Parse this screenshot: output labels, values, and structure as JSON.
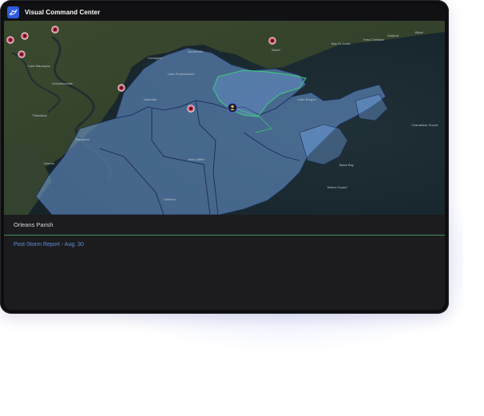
{
  "app": {
    "title": "Visual Command Center",
    "logo_icon": "bird-icon",
    "accent": "#2f5be0"
  },
  "map": {
    "selected_region": "Orleans Parish",
    "highlight_color": "#7fb4ff",
    "boundary_color": "#1b2a55",
    "selected_outline": "#39d17a",
    "place_labels": [
      "Covington",
      "Mandeville",
      "Slidell",
      "Bay St. Louis",
      "Pass Christian",
      "Gulfport",
      "Biloxi",
      "Lake Pontchartrain",
      "Lake Borgne",
      "Breton Sound",
      "Chandeleur Sound",
      "Black Bay",
      "Lake Maurepas",
      "Donaldsonville",
      "Thibodaux",
      "Houma",
      "Raceland",
      "Galliano",
      "Hahnville",
      "Jean Lafitte"
    ],
    "markers": [
      {
        "name": "alert-marker",
        "type": "alert"
      },
      {
        "name": "alert-marker",
        "type": "alert"
      },
      {
        "name": "alert-marker",
        "type": "alert"
      },
      {
        "name": "alert-marker",
        "type": "alert"
      },
      {
        "name": "alert-marker",
        "type": "alert"
      },
      {
        "name": "alert-marker",
        "type": "alert"
      },
      {
        "name": "alert-marker",
        "type": "alert"
      },
      {
        "name": "person-marker",
        "type": "user"
      }
    ]
  },
  "panel": {
    "title": "Orleans Parish",
    "report_link": "Post-Storm Report - Aug. 30"
  }
}
